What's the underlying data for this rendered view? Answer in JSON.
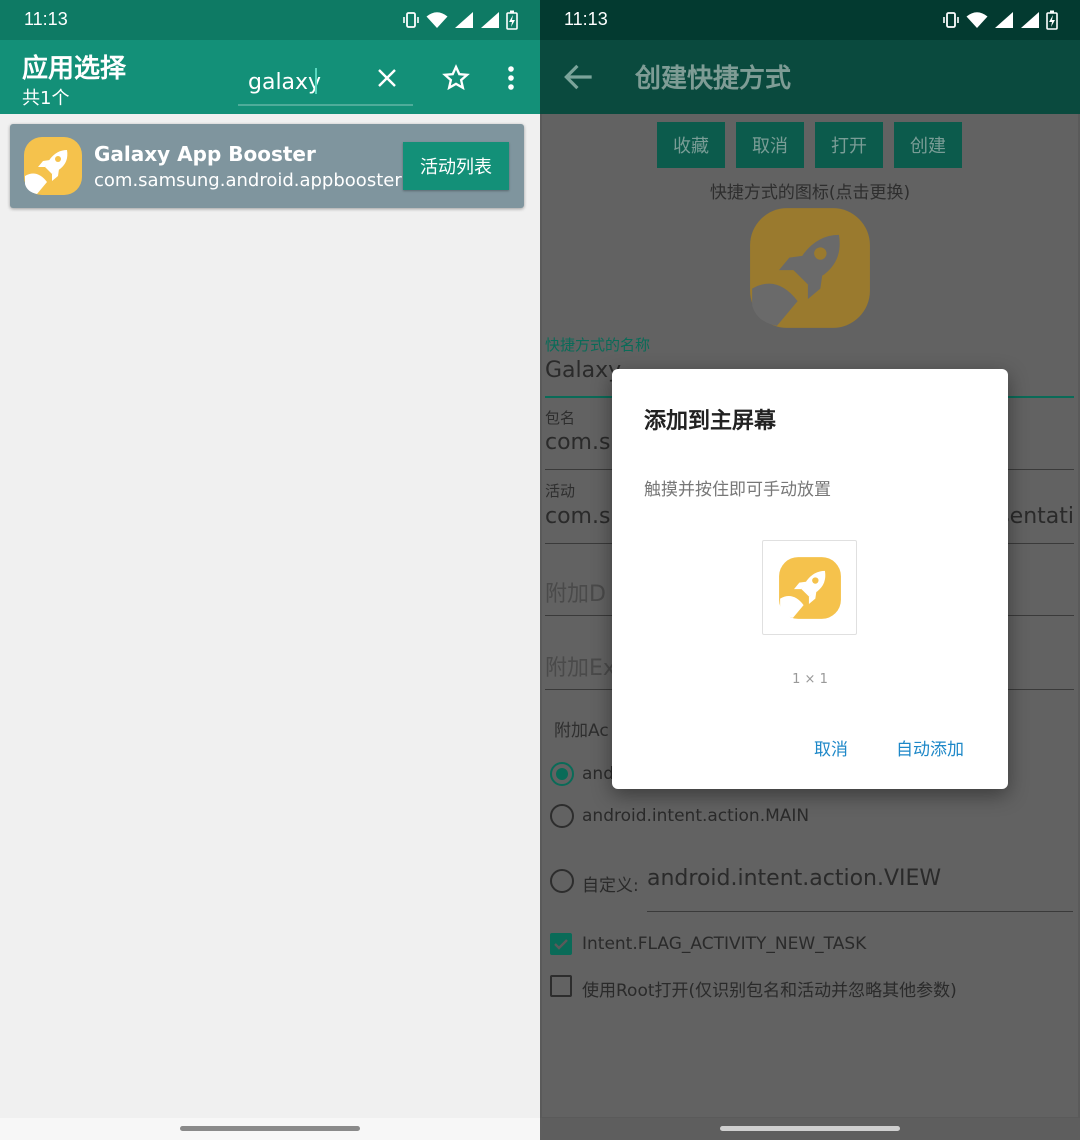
{
  "left": {
    "status": {
      "time": "11:13"
    },
    "toolbar": {
      "title": "应用选择",
      "subtitle": "共1个",
      "search_value": "galaxy"
    },
    "result": {
      "name": "Galaxy App Booster",
      "package": "com.samsung.android.appbooster",
      "button_label": "活动列表"
    }
  },
  "right": {
    "status": {
      "time": "11:13"
    },
    "toolbar": {
      "title": "创建快捷方式"
    },
    "buttons": [
      "收藏",
      "取消",
      "打开",
      "创建"
    ],
    "icon_label": "快捷方式的图标(点击更换)",
    "name_label": "快捷方式的名称",
    "name_value": "Galaxy",
    "package_label": "包名",
    "package_value": "com.s",
    "activity_label": "活动",
    "activity_value_start": "com.s",
    "activity_value_end": "sentati",
    "extra_data_hint": "附加D",
    "extra_extras_hint": "附加Ex",
    "extra_action_label": "附加Ac",
    "action_partial": "and",
    "action_main": "android.intent.action.MAIN",
    "custom_prefix": "自定义:",
    "custom_value": "android.intent.action.VIEW",
    "flag_new_task": "Intent.FLAG_ACTIVITY_NEW_TASK",
    "root_open": "使用Root打开(仅识别包名和活动并忽略其他参数)",
    "dialog": {
      "title": "添加到主屏幕",
      "message": "触摸并按住即可手动放置",
      "size": "1 × 1",
      "cancel": "取消",
      "auto_add": "自动添加"
    }
  }
}
